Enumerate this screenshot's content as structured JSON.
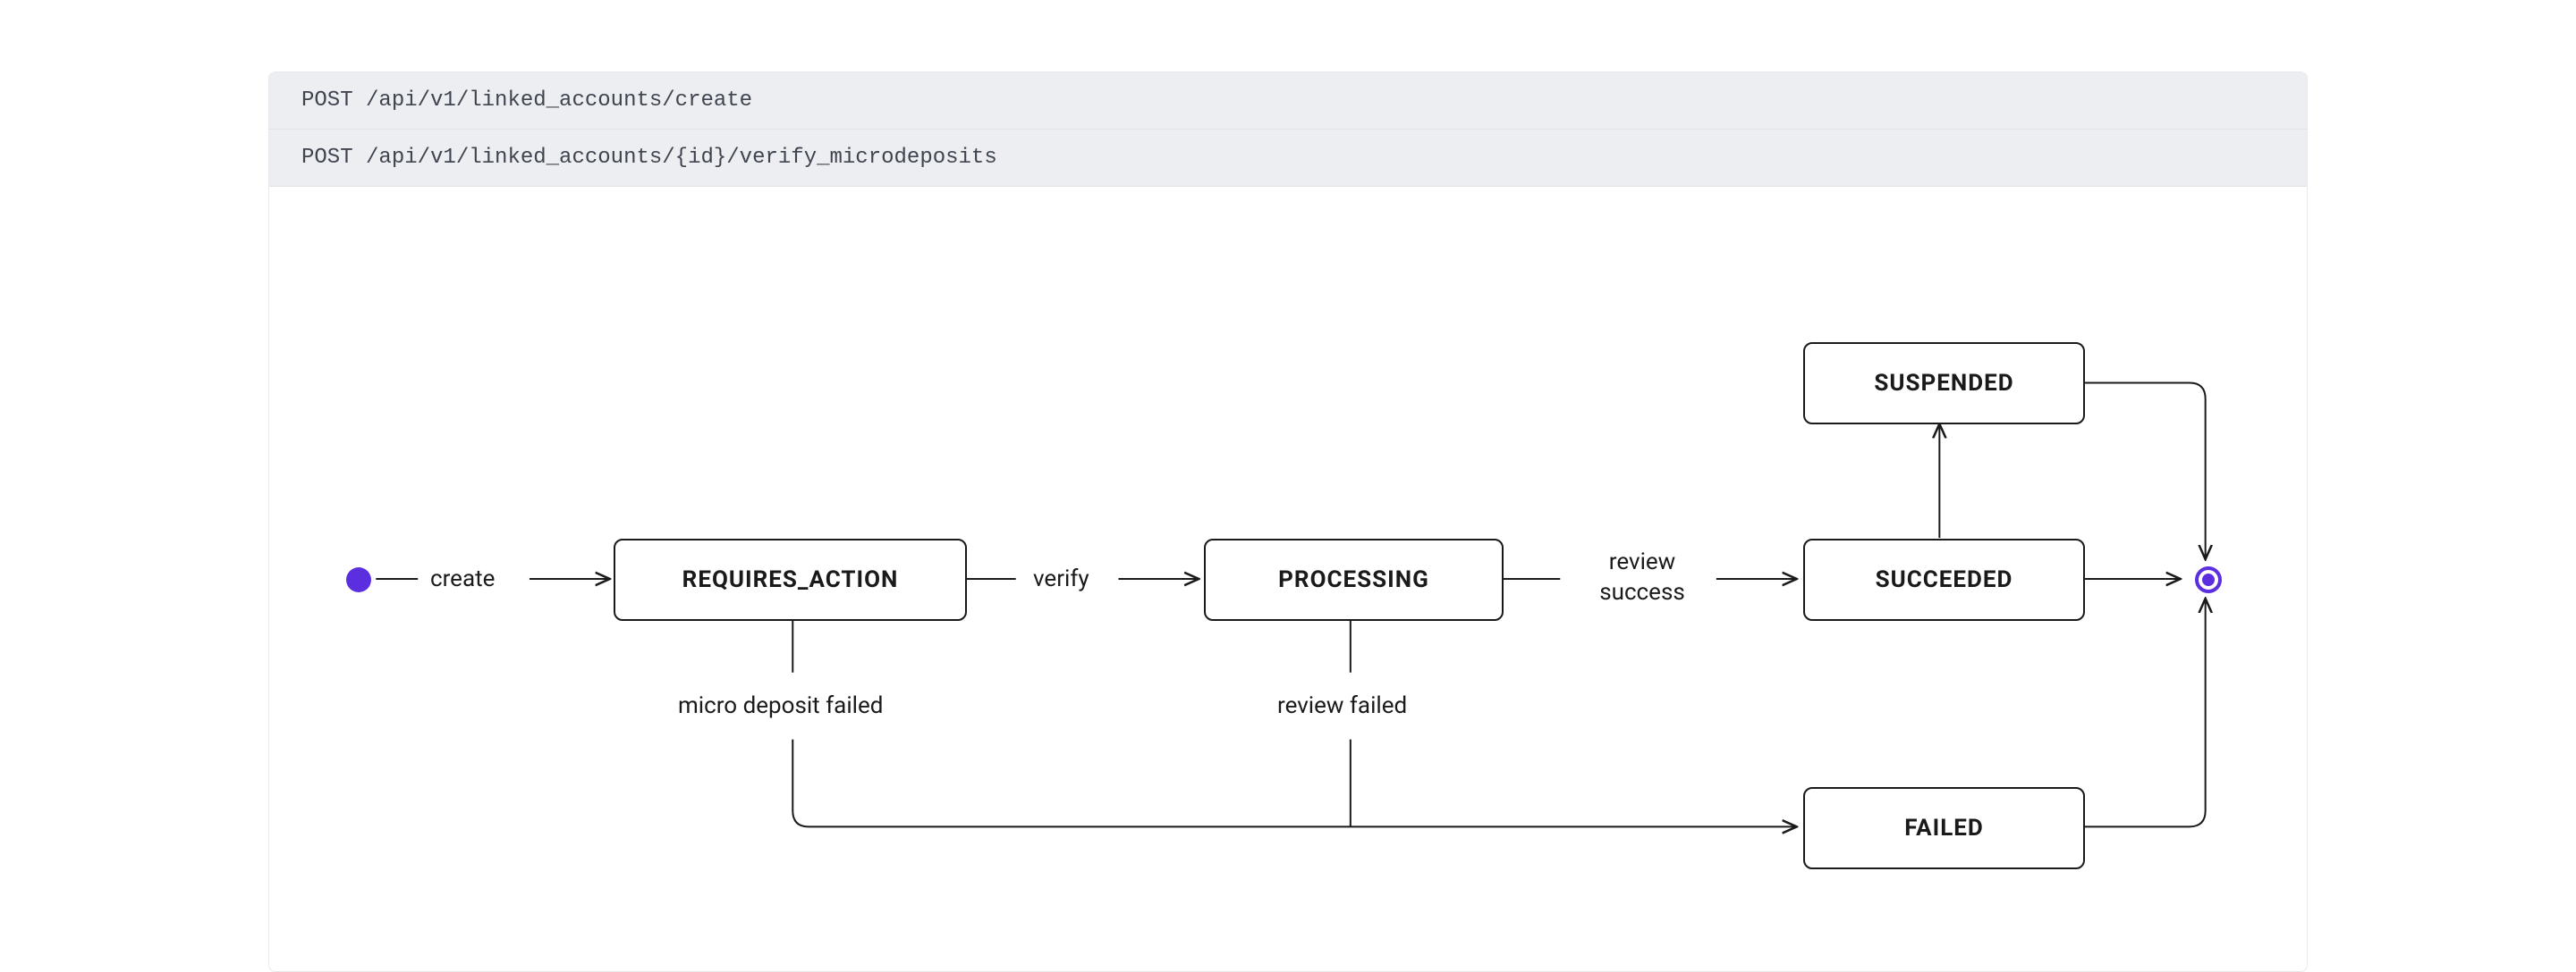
{
  "endpoints": [
    {
      "method": "POST",
      "path": "/api/v1/linked_accounts/create"
    },
    {
      "method": "POST",
      "path": "/api/v1/linked_accounts/{id}/verify_microdeposits"
    }
  ],
  "states": {
    "requires_action": "REQUIRES_ACTION",
    "processing": "PROCESSING",
    "suspended": "SUSPENDED",
    "succeeded": "SUCCEEDED",
    "failed": "FAILED"
  },
  "edges": {
    "create": "create",
    "verify": "verify",
    "review_success": "review\nsuccess",
    "micro_deposit_failed": "micro deposit failed",
    "review_failed": "review failed"
  },
  "colors": {
    "accent": "#5b2ee0",
    "header_bg": "#edeef2",
    "border": "#1a1a1a"
  }
}
